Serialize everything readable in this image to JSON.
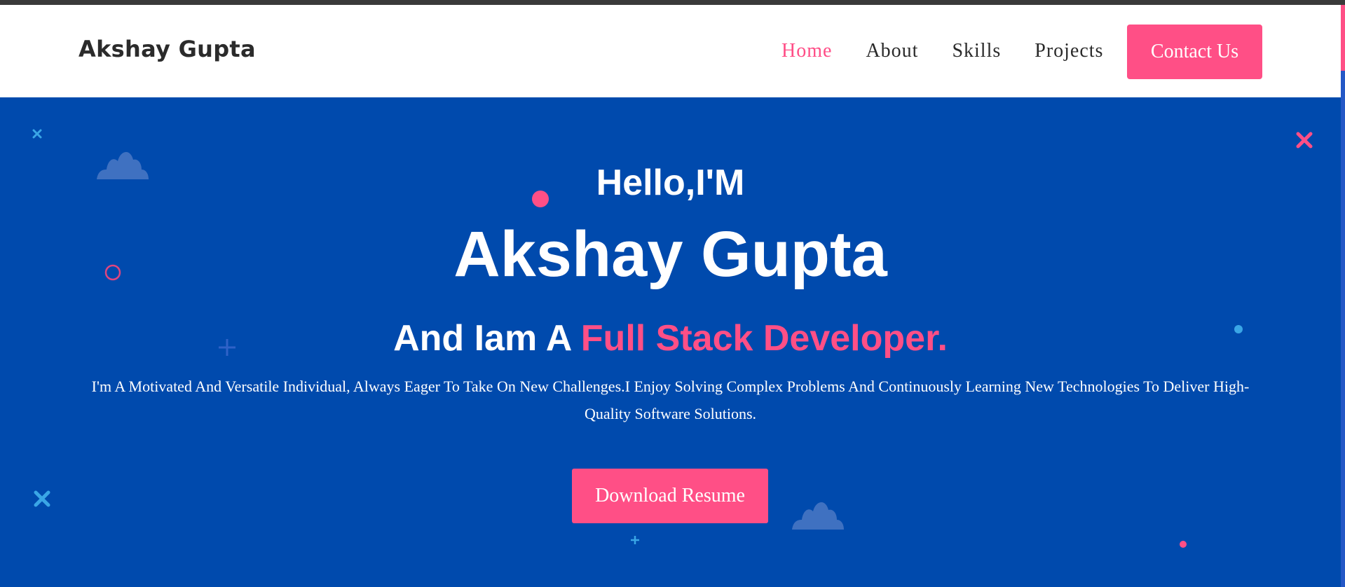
{
  "header": {
    "brand": "Akshay Gupta",
    "nav": [
      {
        "label": "Home",
        "active": true
      },
      {
        "label": "About",
        "active": false
      },
      {
        "label": "Skills",
        "active": false
      },
      {
        "label": "Projects",
        "active": false
      }
    ],
    "contact_label": "Contact Us"
  },
  "hero": {
    "greeting": "Hello,I'M",
    "name": "Akshay Gupta",
    "role_prefix": "And Iam A ",
    "role_highlight": "Full Stack Developer.",
    "description": "I'm A Motivated And Versatile Individual, Always Eager To Take On New Challenges.I Enjoy Solving Complex Problems And Continuously Learning New Technologies To Deliver High-Quality Software Solutions.",
    "resume_label": "Download Resume"
  },
  "colors": {
    "accent": "#ff4f86",
    "hero_bg": "#004aad",
    "brand_text": "#2b2b2b"
  },
  "icons": [
    "cloud-icon",
    "circle-icon",
    "cross-icon",
    "plus-icon",
    "dot-icon"
  ]
}
